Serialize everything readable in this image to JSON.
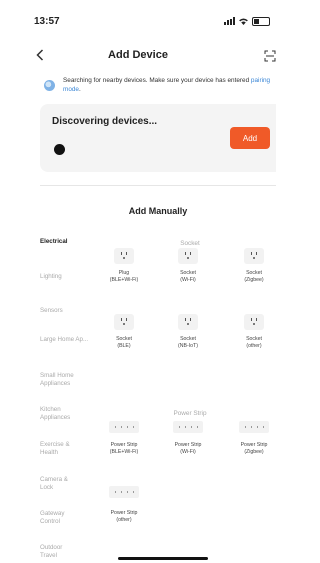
{
  "status_bar": {
    "time": "13:57"
  },
  "nav": {
    "title": "Add Device",
    "back_icon": "chevron-left-icon",
    "scan_icon": "scan-icon"
  },
  "info": {
    "text": "Searching for nearby devices. Make sure your device has entered ",
    "link": "pairing mode",
    "end": "."
  },
  "discover": {
    "title": "Discovering devices...",
    "add_label": "Add"
  },
  "manual_title": "Add Manually",
  "categories": [
    {
      "label": "Electrical",
      "active": true
    },
    {
      "label": "Lighting",
      "active": false
    },
    {
      "label": "Sensors",
      "active": false
    },
    {
      "label": "Large Home Ap...",
      "active": false
    },
    {
      "label": "Small Home Appliances",
      "active": false
    },
    {
      "label": "Kitchen Appliances",
      "active": false
    },
    {
      "label": "Exercise & Health",
      "active": false
    },
    {
      "label": "Camera & Lock",
      "active": false
    },
    {
      "label": "Gateway Control",
      "active": false
    },
    {
      "label": "Outdoor Travel",
      "active": false
    }
  ],
  "sections": [
    {
      "title": "Socket",
      "devices": [
        {
          "line1": "Plug",
          "line2": "(BLE+Wi-Fi)"
        },
        {
          "line1": "Socket",
          "line2": "(Wi-Fi)"
        },
        {
          "line1": "Socket",
          "line2": "(Zigbee)"
        },
        {
          "line1": "Socket",
          "line2": "(BLE)"
        },
        {
          "line1": "Socket",
          "line2": "(NB-IoT)"
        },
        {
          "line1": "Socket",
          "line2": "(other)"
        }
      ]
    },
    {
      "title": "Power Strip",
      "devices": [
        {
          "line1": "Power Strip",
          "line2": "(BLE+Wi-Fi)"
        },
        {
          "line1": "Power Strip",
          "line2": "(Wi-Fi)"
        },
        {
          "line1": "Power Strip",
          "line2": "(Zigbee)"
        },
        {
          "line1": "Power Strip",
          "line2": "(other)"
        }
      ]
    }
  ],
  "colors": {
    "accent": "#f05a28",
    "link": "#3a86d6"
  }
}
